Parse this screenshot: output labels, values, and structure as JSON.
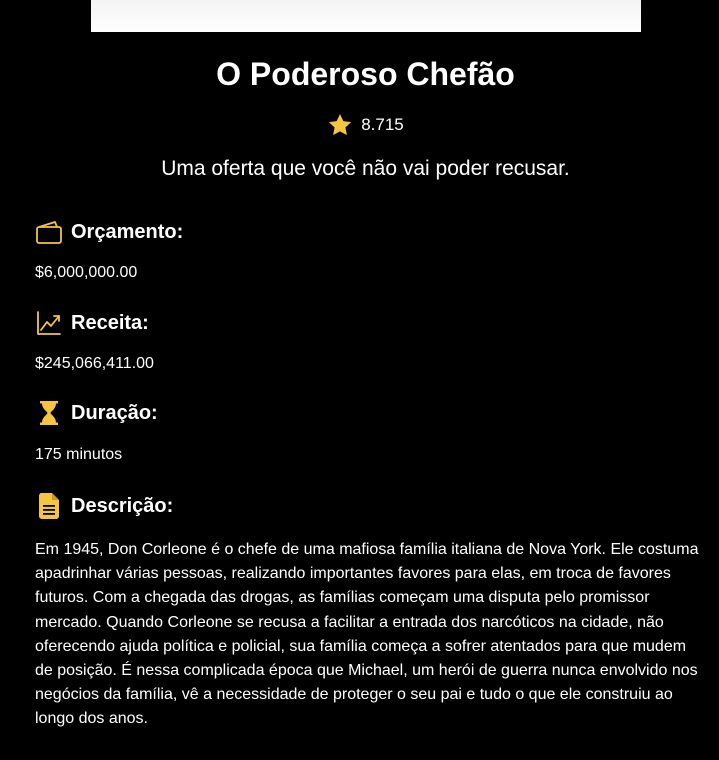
{
  "movie": {
    "title": "O Poderoso Chefão",
    "rating": "8.715",
    "tagline": "Uma oferta que você não vai poder recusar."
  },
  "details": {
    "budget_label": "Orçamento:",
    "budget_value": "$6,000,000.00",
    "revenue_label": "Receita:",
    "revenue_value": "$245,066,411.00",
    "runtime_label": "Duração:",
    "runtime_value": "175 minutos",
    "overview_label": "Descrição:",
    "overview_text": "Em 1945, Don Corleone é o chefe de uma mafiosa família italiana de Nova York. Ele costuma apadrinhar várias pessoas, realizando importantes favores para elas, em troca de favores futuros. Com a chegada das drogas, as famílias começam uma disputa pelo promissor mercado. Quando Corleone se recusa a facilitar a entrada dos narcóticos na cidade, não oferecendo ajuda política e policial, sua família começa a sofrer atentados para que mudem de posição. É nessa complicada época que Michael, um herói de guerra nunca envolvido nos negócios da família, vê a necessidade de proteger o seu pai e tudo o que ele construiu ao longo dos anos."
  },
  "icons": {
    "star": "star-icon",
    "budget": "wallet-icon",
    "revenue": "trend-up-icon",
    "runtime": "hourglass-icon",
    "overview": "document-icon"
  },
  "colors": {
    "background": "#000000",
    "text": "#ffffff",
    "accent": "#f5c542"
  }
}
